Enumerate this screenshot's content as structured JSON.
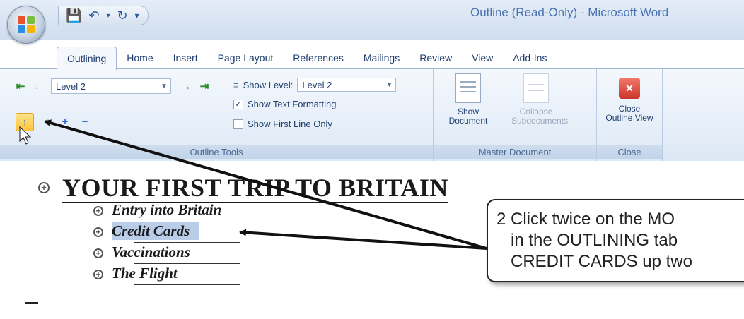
{
  "window": {
    "title_doc": "Outline (Read-Only)",
    "title_sep": " - ",
    "title_app": "Microsoft Word"
  },
  "quick_access": {
    "save_icon": "save-icon",
    "undo_icon": "undo-icon",
    "redo_icon": "redo-icon",
    "customize_icon": "customize-icon"
  },
  "tabs": [
    "Outlining",
    "Home",
    "Insert",
    "Page Layout",
    "References",
    "Mailings",
    "Review",
    "View",
    "Add-Ins"
  ],
  "ribbon": {
    "outline_tools": {
      "label": "Outline Tools",
      "level_value": "Level 2",
      "show_level_label": "Show Level:",
      "show_level_value": "Level 2",
      "show_text_formatting": "Show Text Formatting",
      "show_first_line_only": "Show First Line Only"
    },
    "master_document": {
      "label": "Master Document",
      "show_document": "Show Document",
      "collapse_subdocuments": "Collapse Subdocuments"
    },
    "close": {
      "label": "Close",
      "close_outline_view": "Close Outline View"
    }
  },
  "document": {
    "heading": "YOUR FIRST TRIP TO BRITAIN",
    "items": [
      "Entry into Britain",
      "Credit Cards",
      "Vaccinations",
      "The Flight"
    ]
  },
  "callout": {
    "text": "2 Click twice on the MO\n   in the OUTLINING tab\n   CREDIT CARDS up two"
  },
  "colors": {
    "ribbon": "#dde8f5",
    "highlight": "#b9cde9",
    "selected_button": "#ffc33a"
  }
}
